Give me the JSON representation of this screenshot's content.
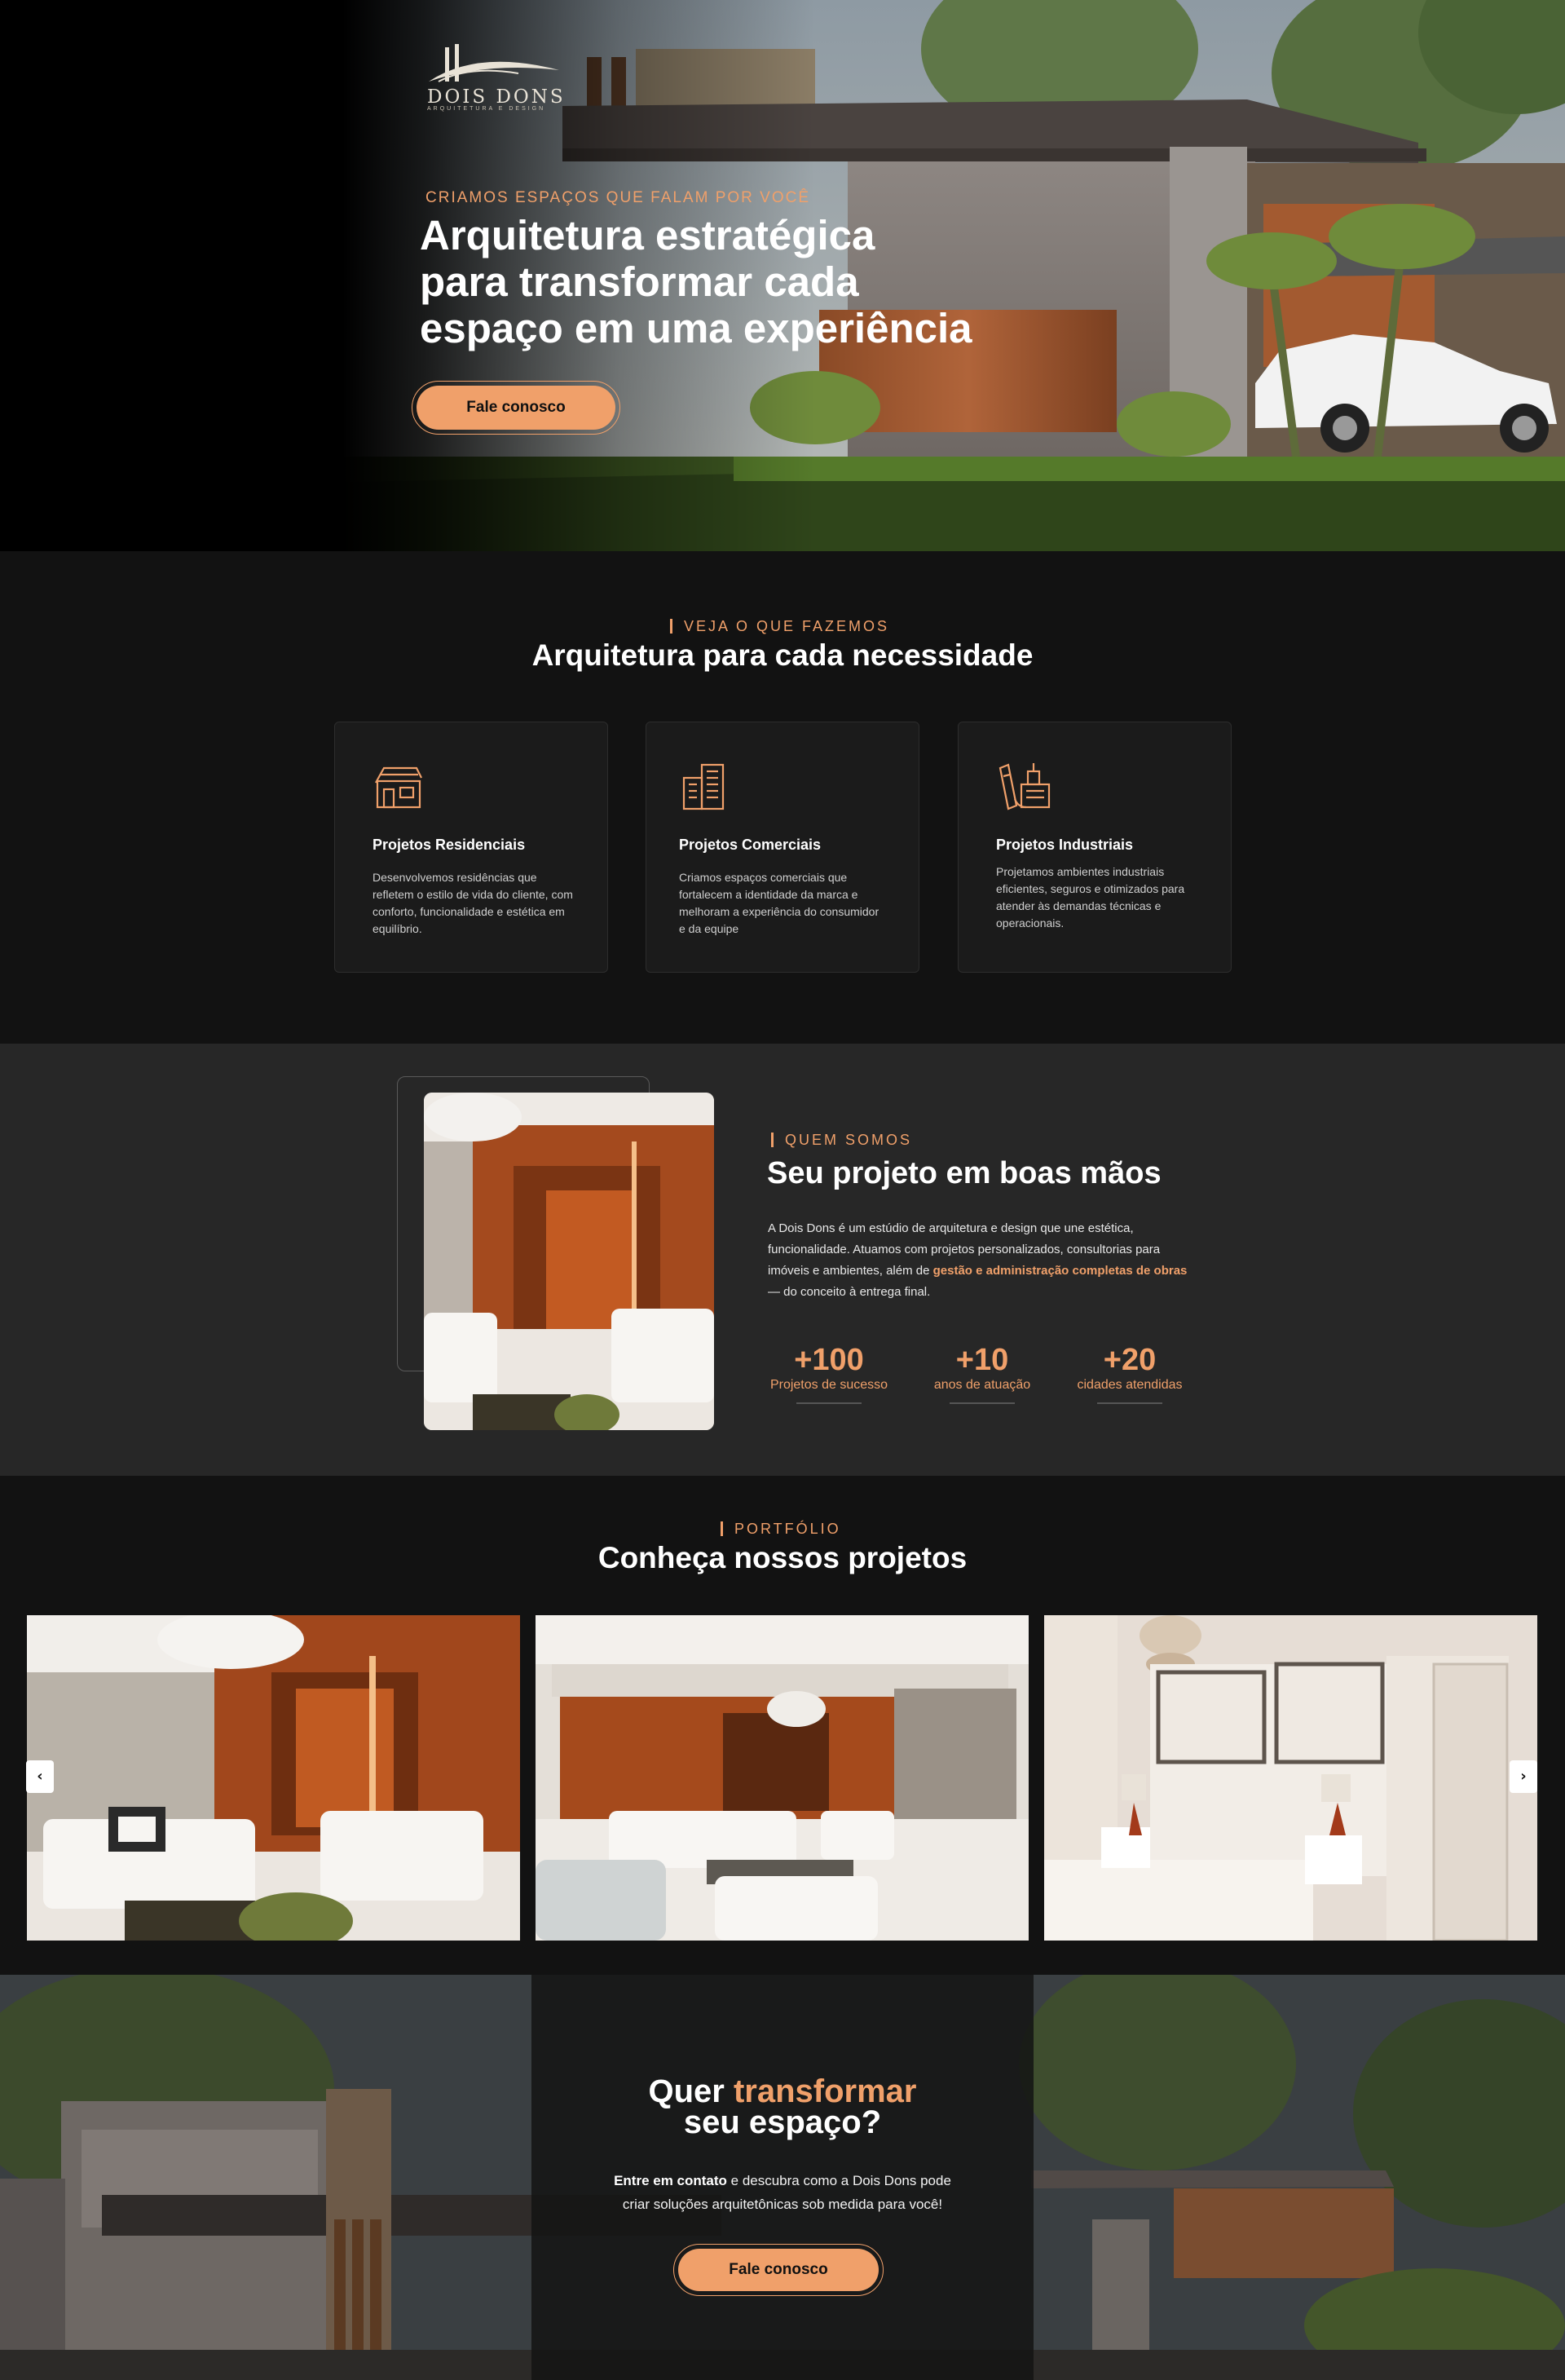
{
  "brand": {
    "name": "DOIS DONS",
    "tagline": "ARQUITETURA E DESIGN"
  },
  "colors": {
    "accent": "#f0a06a",
    "background_dark": "#121212",
    "background_mid": "#272727",
    "card": "#1b1b1b"
  },
  "hero": {
    "eyebrow": "CRIAMOS ESPAÇOS QUE FALAM POR VOCÊ",
    "title_line1": "Arquitetura estratégica",
    "title_line2": "para transformar cada",
    "title_line3": "espaço em uma experiência",
    "cta_label": "Fale conosco"
  },
  "services": {
    "eyebrow": "VEJA O QUE FAZEMOS",
    "title": "Arquitetura para cada necessidade",
    "cards": [
      {
        "icon": "house-icon",
        "title": "Projetos Residenciais",
        "text": "Desenvolvemos residências que refletem o estilo de vida do cliente, com conforto, funcionalidade e estética em equilíbrio."
      },
      {
        "icon": "buildings-icon",
        "title": "Projetos Comerciais",
        "text": "Criamos espaços comerciais que fortalecem a identidade da marca e melhoram a experiência do consumidor e da equipe"
      },
      {
        "icon": "blueprint-icon",
        "title": "Projetos Industriais",
        "text": "Projetamos ambientes industriais eficientes, seguros e otimizados para atender às demandas técnicas e operacionais."
      }
    ]
  },
  "about": {
    "eyebrow": "QUEM SOMOS",
    "title": "Seu projeto em boas mãos",
    "text_before": "A Dois Dons é um estúdio de arquitetura e design que une estética, funcionalidade. Atuamos com projetos personalizados, consultorias para imóveis e ambientes, além de ",
    "text_highlight": "gestão e administração completas de obras",
    "text_after": " — do conceito à entrega final.",
    "stats": [
      {
        "value": "+100",
        "label": "Projetos de sucesso"
      },
      {
        "value": "+10",
        "label": "anos de atuação"
      },
      {
        "value": "+20",
        "label": "cidades atendidas"
      }
    ]
  },
  "portfolio": {
    "eyebrow": "PORTFÓLIO",
    "title": "Conheça nossos projetos",
    "prev_icon": "chevron-left-icon",
    "next_icon": "chevron-right-icon",
    "prev_glyph": "‹",
    "next_glyph": "›"
  },
  "cta": {
    "title_start": "Quer ",
    "title_accent": "transformar",
    "title_end": "seu espaço?",
    "text_bold": "Entre em contato",
    "text_rest_line1": " e descubra como a Dois Dons pode",
    "text_line2": "criar soluções arquitetônicas sob medida para você!",
    "button_label": "Fale conosco"
  }
}
